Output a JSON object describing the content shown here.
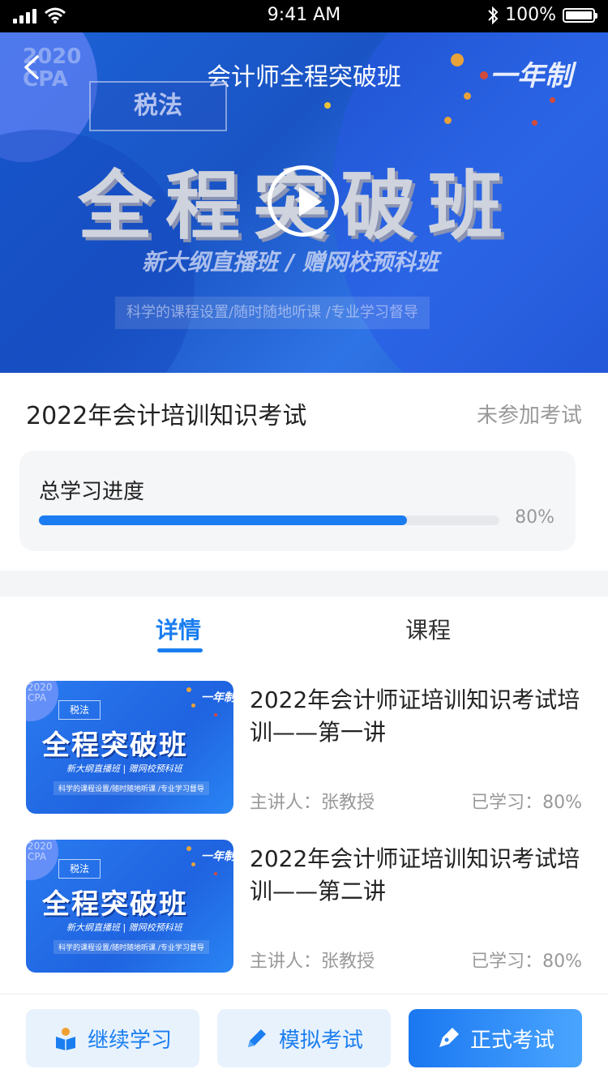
{
  "status_bar": {
    "time": "9:41 AM",
    "battery": "100%"
  },
  "banner": {
    "title": "会计师全程突破班",
    "cpa_text": "2020\nCPA",
    "tag": "税法",
    "yearly": "一年制",
    "headline": "全程突破班",
    "subtitle": "新大纲直播班 / 赠网校预科班",
    "slogan": "科学的课程设置/随时随地听课 /专业学习督导"
  },
  "course": {
    "title": "2022年会计培训知识考试",
    "exam_status": "未参加考试",
    "progress_label": "总学习进度",
    "progress_value": 0.8,
    "progress_text": "80%"
  },
  "tabs": [
    {
      "label": "详情",
      "active": true
    },
    {
      "label": "课程",
      "active": false
    }
  ],
  "thumbnail": {
    "cpa": "2020\nCPA",
    "yearly": "一年制",
    "tag": "税法",
    "headline": "全程突破班",
    "subtitle": "新大纲直播班 | 赠网校预科班",
    "slogan": "科学的课程设置/随时随地听课 /专业学习督导"
  },
  "lessons": [
    {
      "name": "2022年会计师证培训知识考试培训——第一讲",
      "lecturer": "主讲人：张教授",
      "studied": "已学习：80%"
    },
    {
      "name": "2022年会计师证培训知识考试培训——第二讲",
      "lecturer": "主讲人：张教授",
      "studied": "已学习：80%"
    }
  ],
  "actions": {
    "continue": "继续学习",
    "mock": "模拟考试",
    "exam": "正式考试"
  },
  "colors": {
    "accent": "#1a7ef0",
    "button_light": "#e8f2fd"
  }
}
